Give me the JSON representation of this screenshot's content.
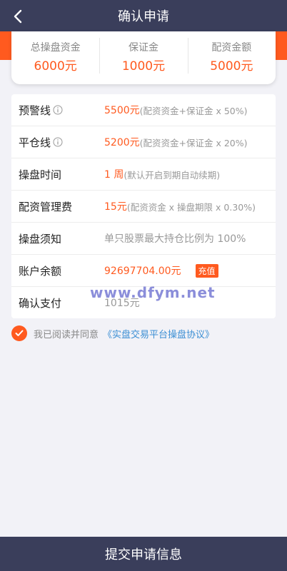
{
  "header": {
    "title": "确认申请",
    "back_icon": "chevron-left-icon"
  },
  "summary": [
    {
      "label": "总操盘资金",
      "value": "6000元"
    },
    {
      "label": "保证金",
      "value": "1000元"
    },
    {
      "label": "配资金额",
      "value": "5000元"
    }
  ],
  "rows": {
    "warning": {
      "label": "预警线",
      "value": "5500元",
      "note": "(配资资金+保证金 x 50%)"
    },
    "liquidation": {
      "label": "平仓线",
      "value": "5200元",
      "note": " (配资资金+保证金 x 20%)"
    },
    "period": {
      "label": "操盘时间",
      "value": "1 周",
      "note": "(默认开启到期自动续期)"
    },
    "fee": {
      "label": "配资管理费",
      "value": "15元",
      "note": "(配资资金 x 操盘期限 x 0.30%)"
    },
    "rules": {
      "label": "操盘须知",
      "value": "单只股票最大持仓比例为 100%"
    },
    "balance": {
      "label": "账户余额",
      "value": "92697704.00元",
      "recharge": "充值"
    },
    "pay": {
      "label": "确认支付",
      "value": "1015元"
    }
  },
  "watermark": "www.dfym.net",
  "agreement": {
    "text": "我已阅读并同意",
    "link": "《实盘交易平台操盘协议》",
    "checked": true
  },
  "submit_label": "提交申请信息",
  "colors": {
    "accent": "#ff5a1f",
    "header": "#3a3e5b",
    "link": "#3c8fd4"
  }
}
